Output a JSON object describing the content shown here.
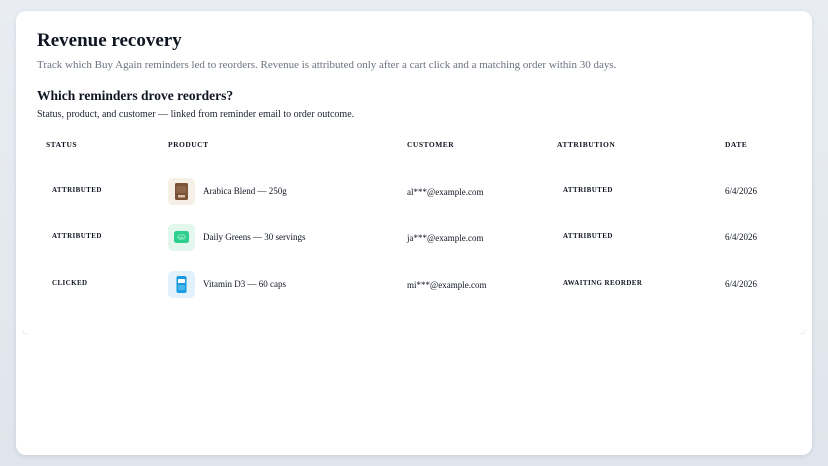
{
  "header": {
    "title": "Revenue recovery",
    "subtitle": "Track which Buy Again reminders led to reorders. Revenue is attributed only after a cart click and a matching order within 30 days."
  },
  "section": {
    "title": "Which reminders drove reorders?",
    "subtitle": "Status, product, and customer — linked from reminder email to order outcome."
  },
  "table": {
    "columns": [
      "STATUS",
      "PRODUCT",
      "CUSTOMER",
      "ATTRIBUTION",
      "DATE"
    ],
    "rows": [
      {
        "status": "ATTRIBUTED",
        "product": "Arabica Blend — 250g",
        "product_icon": "coffee-bag-icon",
        "customer": "al***@example.com",
        "attribution": "ATTRIBUTED",
        "date": "6/4/2026"
      },
      {
        "status": "ATTRIBUTED",
        "product": "Daily Greens — 30 servings",
        "product_icon": "greens-pouch-icon",
        "customer": "ja***@example.com",
        "attribution": "ATTRIBUTED",
        "date": "6/4/2026"
      },
      {
        "status": "CLICKED",
        "product": "Vitamin D3 — 60 caps",
        "product_icon": "vitamin-bottle-icon",
        "customer": "mi***@example.com",
        "attribution": "AWAITING REORDER",
        "date": "6/4/2026"
      }
    ]
  },
  "colors": {
    "background": "#e5eaf0",
    "card": "#ffffff",
    "text": "#0f1521",
    "muted": "#6b7380",
    "coffee": "#7a5236",
    "greens": "#2ecf8e",
    "vitamin": "#1a9be0"
  }
}
